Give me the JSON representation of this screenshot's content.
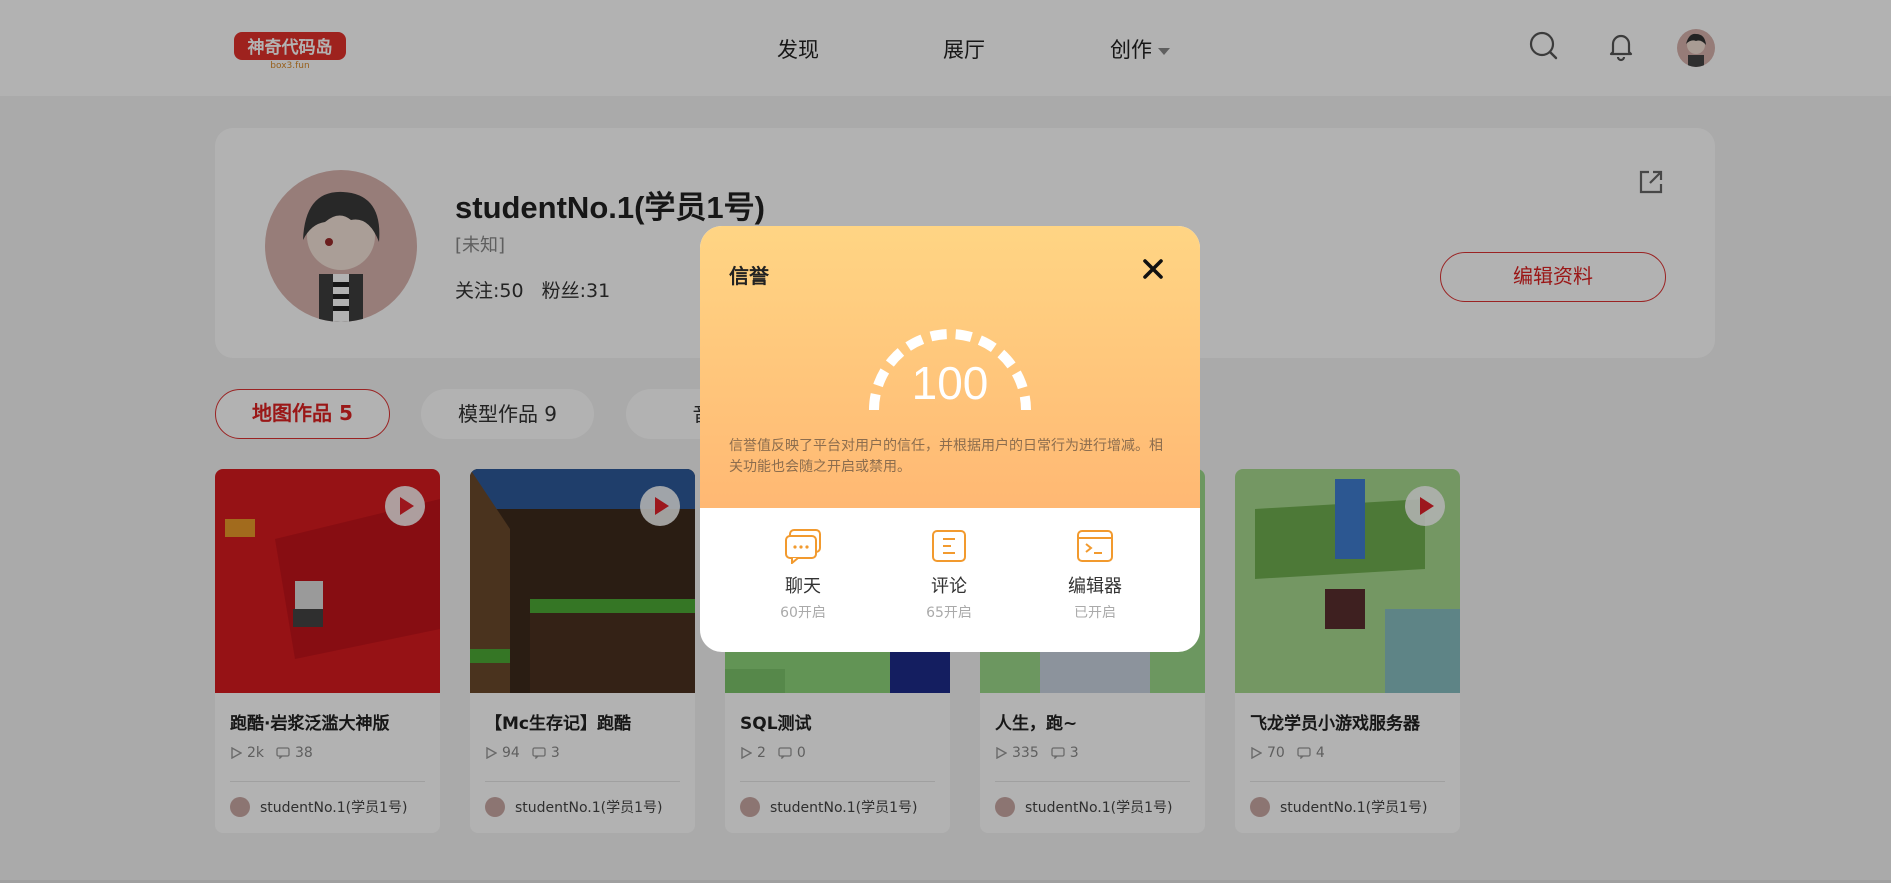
{
  "header": {
    "logo_text": "神奇代码岛",
    "logo_sub": "box3.fun",
    "nav": [
      {
        "label": "发现"
      },
      {
        "label": "展厅"
      },
      {
        "label": "创作"
      }
    ],
    "icons": [
      "search-icon",
      "bell-icon",
      "avatar"
    ]
  },
  "profile": {
    "username": "studentNo.1(学员1号)",
    "gender": "[未知]",
    "following": "关注:50",
    "followers": "粉丝:31",
    "edit_label": "编辑资料"
  },
  "tabs": [
    {
      "label": "地图作品 5",
      "active": true
    },
    {
      "label": "模型作品 9",
      "active": false
    },
    {
      "label": "音乐",
      "active": false
    }
  ],
  "cards": [
    {
      "title": "跑酷·岩浆泛滥大神版",
      "plays": "2k",
      "comments": "38",
      "author": "studentNo.1(学员1号)"
    },
    {
      "title": "【Mc生存记】跑酷",
      "plays": "94",
      "comments": "3",
      "author": "studentNo.1(学员1号)"
    },
    {
      "title": "SQL测试",
      "plays": "2",
      "comments": "0",
      "author": "studentNo.1(学员1号)"
    },
    {
      "title": "人生，跑~",
      "plays": "335",
      "comments": "3",
      "author": "studentNo.1(学员1号)"
    },
    {
      "title": "飞龙学员小游戏服务器",
      "plays": "70",
      "comments": "4",
      "author": "studentNo.1(学员1号)"
    }
  ],
  "modal": {
    "title": "信誉",
    "score": "100",
    "description": "信誉值反映了平台对用户的信任，并根据用户的日常行为进行增减。相关功能也会随之开启或禁用。",
    "features": [
      {
        "name": "聊天",
        "sub": "60开启",
        "icon": "chat-icon"
      },
      {
        "name": "评论",
        "sub": "65开启",
        "icon": "comment-icon"
      },
      {
        "name": "编辑器",
        "sub": "已开启",
        "icon": "editor-icon"
      }
    ]
  },
  "colors": {
    "accent": "#e0222a",
    "modal_gradient_top": "#ffd584",
    "modal_gradient_bottom": "#ffb873",
    "feature_icon": "#f29a2e"
  }
}
